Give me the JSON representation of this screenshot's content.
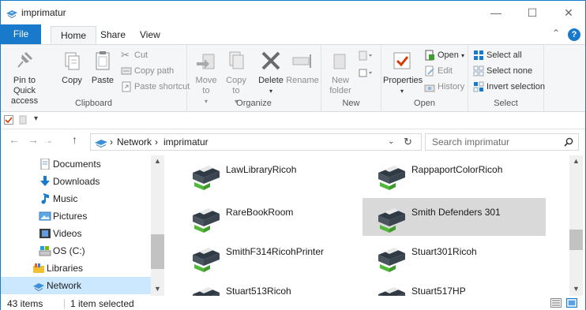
{
  "window": {
    "title": "imprimatur"
  },
  "tabs": [
    {
      "label": "File"
    },
    {
      "label": "Home"
    },
    {
      "label": "Share"
    },
    {
      "label": "View"
    }
  ],
  "ribbon": {
    "clipboard": {
      "label": "Clipboard",
      "pin": "Pin to Quick access",
      "copy": "Copy",
      "paste": "Paste",
      "cut": "Cut",
      "copy_path": "Copy path",
      "paste_shortcut": "Paste shortcut"
    },
    "organize": {
      "label": "Organize",
      "move_to": "Move to",
      "copy_to": "Copy to",
      "delete": "Delete",
      "rename": "Rename"
    },
    "new": {
      "label": "New",
      "new_folder": "New folder"
    },
    "open": {
      "label": "Open",
      "properties": "Properties",
      "open": "Open",
      "edit": "Edit",
      "history": "History"
    },
    "select": {
      "label": "Select",
      "select_all": "Select all",
      "select_none": "Select none",
      "invert": "Invert selection"
    }
  },
  "address": {
    "crumbs": [
      "Network",
      "imprimatur"
    ],
    "search_placeholder": "Search imprimatur"
  },
  "nav_pane": {
    "items": [
      {
        "label": "Documents",
        "icon": "documents-icon"
      },
      {
        "label": "Downloads",
        "icon": "downloads-icon"
      },
      {
        "label": "Music",
        "icon": "music-icon"
      },
      {
        "label": "Pictures",
        "icon": "pictures-icon"
      },
      {
        "label": "Videos",
        "icon": "videos-icon"
      },
      {
        "label": "OS (C:)",
        "icon": "drive-icon"
      },
      {
        "label": "Libraries",
        "icon": "libraries-icon"
      },
      {
        "label": "Network",
        "icon": "network-icon",
        "selected": true
      }
    ]
  },
  "printers": [
    {
      "name": "LawLibraryRicoh"
    },
    {
      "name": "RappaportColorRicoh"
    },
    {
      "name": "RareBookRoom"
    },
    {
      "name": "Smith Defenders 301",
      "selected": true
    },
    {
      "name": "SmithF314RicohPrinter"
    },
    {
      "name": "Stuart301Ricoh"
    },
    {
      "name": "Stuart513Ricoh"
    },
    {
      "name": "Stuart517HP"
    }
  ],
  "status": {
    "item_count": "43 items",
    "selection": "1 item selected"
  },
  "colors": {
    "accent": "#1979ca",
    "selection": "#cce8ff",
    "tile_selected": "#d9d9d9"
  }
}
